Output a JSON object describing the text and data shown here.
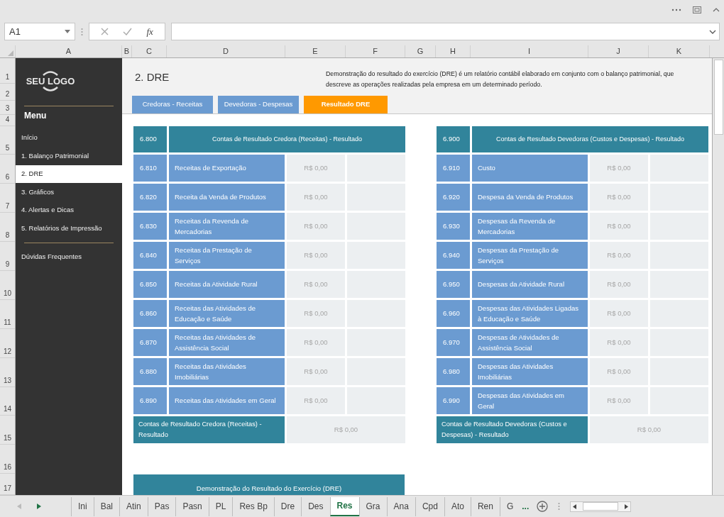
{
  "formula_bar": {
    "name_box": "A1",
    "function_label": "fx"
  },
  "column_headers": [
    "A",
    "B",
    "C",
    "D",
    "E",
    "F",
    "G",
    "H",
    "I",
    "J",
    "K"
  ],
  "row_headers": [
    "1",
    "2",
    "3",
    "4",
    "5",
    "6",
    "7",
    "8",
    "9",
    "10",
    "11",
    "12",
    "13",
    "14",
    "15",
    "16",
    "17"
  ],
  "sidebar": {
    "logo": "SEU LOGO",
    "menu_title": "Menu",
    "items": [
      {
        "label": "Início",
        "selected": false
      },
      {
        "label": "1. Balanço Patrimonial",
        "selected": false
      },
      {
        "label": "2. DRE",
        "selected": true
      },
      {
        "label": "3. Gráficos",
        "selected": false
      },
      {
        "label": "4. Alertas e Dicas",
        "selected": false
      },
      {
        "label": "5. Relatórios de Impressão",
        "selected": false
      }
    ],
    "footer_items": [
      {
        "label": "Dúvidas Frequentes",
        "selected": false
      }
    ]
  },
  "header": {
    "title": "2. DRE",
    "description": "Demonstração do resultado do exercício (DRE) é um relatório contábil elaborado em conjunto com o balanço patrimonial, que descreve as operações realizadas pela empresa em um determinado período.",
    "tabs": [
      {
        "label": "Credoras - Receitas",
        "selected": false
      },
      {
        "label": "Devedoras - Despesas",
        "selected": false
      },
      {
        "label": "Resultado DRE",
        "selected": true
      }
    ]
  },
  "tables": [
    {
      "code": "6.800",
      "title": "Contas de Resultado Credora (Receitas) - Resultado",
      "rows": [
        {
          "code": "6.810",
          "name": "Receitas de Exportação",
          "value": "R$ 0,00"
        },
        {
          "code": "6.820",
          "name": "Receita da Venda de Produtos",
          "value": "R$ 0,00"
        },
        {
          "code": "6.830",
          "name": "Receitas da Revenda de Mercadorias",
          "value": "R$ 0,00"
        },
        {
          "code": "6.840",
          "name": "Receitas da Prestação de Serviços",
          "value": "R$ 0,00"
        },
        {
          "code": "6.850",
          "name": "Receitas da Atividade Rural",
          "value": "R$ 0,00"
        },
        {
          "code": "6.860",
          "name": "Receitas das Atividades de Educação e Saúde",
          "value": "R$ 0,00"
        },
        {
          "code": "6.870",
          "name": "Receitas das Atividades de Assistência Social",
          "value": "R$ 0,00"
        },
        {
          "code": "6.880",
          "name": "Receitas das Atividades Imobiliárias",
          "value": "R$ 0,00"
        },
        {
          "code": "6.890",
          "name": "Receitas das Atividades em Geral",
          "value": "R$ 0,00"
        }
      ],
      "total": {
        "label": "Contas de Resultado Credora (Receitas) - Resultado",
        "value": "R$ 0,00"
      }
    },
    {
      "code": "6.900",
      "title": "Contas de Resultado Devedoras (Custos e Despesas) - Resultado",
      "rows": [
        {
          "code": "6.910",
          "name": "Custo",
          "value": "R$ 0,00"
        },
        {
          "code": "6.920",
          "name": "Despesa da Venda de Produtos",
          "value": "R$ 0,00"
        },
        {
          "code": "6.930",
          "name": "Despesas da Revenda de Mercadorias",
          "value": "R$ 0,00"
        },
        {
          "code": "6.940",
          "name": "Despesas da Prestação de Serviços",
          "value": "R$ 0,00"
        },
        {
          "code": "6.950",
          "name": "Despesas da Atividade Rural",
          "value": "R$ 0,00"
        },
        {
          "code": "6.960",
          "name": "Despesas das Atividades Ligadas à Educação e Saúde",
          "value": "R$ 0,00"
        },
        {
          "code": "6.970",
          "name": "Despesas de Atividades de Assistência Social",
          "value": "R$ 0,00"
        },
        {
          "code": "6.980",
          "name": "Despesas das Atividades Imobiliárias",
          "value": "R$ 0,00"
        },
        {
          "code": "6.990",
          "name": "Despesas das Atividades em Geral",
          "value": "R$ 0,00"
        }
      ],
      "total": {
        "label": "Contas de Resultado Devedoras (Custos e Despesas) - Resultado",
        "value": "R$ 0,00"
      }
    }
  ],
  "section_title": "Demonstração do Resultado do Exercício (DRE)",
  "sheet_tabs": [
    {
      "label": "Ini",
      "selected": false
    },
    {
      "label": "Bal",
      "selected": false
    },
    {
      "label": "Atin",
      "selected": false
    },
    {
      "label": "Pas",
      "selected": false
    },
    {
      "label": "Pasn",
      "selected": false
    },
    {
      "label": "PL",
      "selected": false
    },
    {
      "label": "Res Bp",
      "selected": false
    },
    {
      "label": "Dre",
      "selected": false
    },
    {
      "label": "Des",
      "selected": false
    },
    {
      "label": "Res",
      "selected": true
    },
    {
      "label": "Gra",
      "selected": false
    },
    {
      "label": "Ana",
      "selected": false
    },
    {
      "label": "Cpd",
      "selected": false
    },
    {
      "label": "Ato",
      "selected": false
    },
    {
      "label": "Ren",
      "selected": false
    },
    {
      "label": "G",
      "selected": false
    }
  ],
  "more_tabs": "..."
}
